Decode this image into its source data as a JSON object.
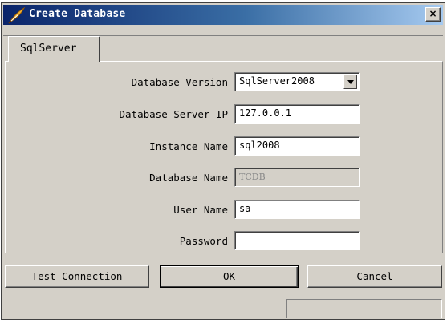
{
  "window": {
    "title": "Create Database",
    "close_glyph": "×",
    "title_icon": "feather-quill-icon"
  },
  "tabs": [
    {
      "label": "SqlServer",
      "active": true
    }
  ],
  "form": {
    "database_version": {
      "label": "Database Version",
      "value": "SqlServer2008"
    },
    "server_ip": {
      "label": "Database Server IP",
      "value": "127.0.0.1"
    },
    "instance_name": {
      "label": "Instance Name",
      "value": "sql2008"
    },
    "database_name": {
      "label": "Database Name",
      "value": "TCDB",
      "disabled": true
    },
    "user_name": {
      "label": "User Name",
      "value": "sa"
    },
    "password": {
      "label": "Password",
      "value": ""
    }
  },
  "buttons": {
    "test_connection": "Test Connection",
    "ok": "OK",
    "cancel": "Cancel"
  },
  "status": {
    "text": ""
  },
  "colors": {
    "title_start": "#0a246a",
    "title_end": "#a6caf0",
    "face": "#d4d0c8"
  }
}
